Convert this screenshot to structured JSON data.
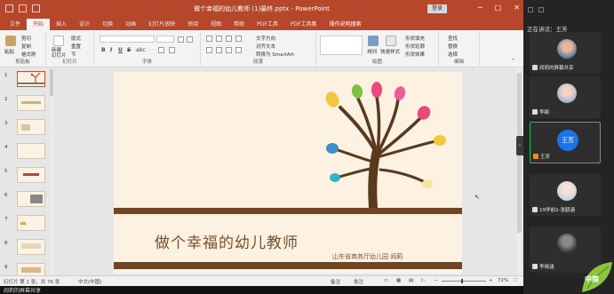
{
  "window": {
    "title": "做个幸福的幼儿教师 (1)最终.pptx - PowerPoint",
    "login_label": "登录",
    "controls": [
      "─",
      "□",
      "✕"
    ]
  },
  "tabs": [
    "文件",
    "开始",
    "插入",
    "设计",
    "切换",
    "动画",
    "幻灯片放映",
    "审阅",
    "视图",
    "帮助",
    "PDF工具",
    "PDF工具集",
    "操作说明搜索"
  ],
  "active_tab": "开始",
  "ribbon": {
    "clipboard": {
      "label": "剪贴板",
      "paste": "粘贴",
      "cut": "剪切",
      "copy": "复制",
      "format_painter": "格式刷"
    },
    "slides": {
      "label": "幻灯片",
      "new_slide": "新建\n幻灯片",
      "layout": "版式",
      "reset": "重置",
      "section": "节"
    },
    "font": {
      "label": "字体",
      "bold": "B",
      "italic": "I",
      "underline": "U",
      "strike": "S",
      "shadow": "abc"
    },
    "paragraph": {
      "label": "段落",
      "text_direction": "文字方向",
      "align_text": "对齐文本",
      "smartart": "转换为 SmartArt"
    },
    "drawing": {
      "label": "绘图",
      "arrange": "排列",
      "quick_styles": "快速样式",
      "fill": "形状填充",
      "outline": "形状轮廓",
      "effects": "形状效果"
    },
    "editing": {
      "label": "编辑",
      "find": "查找",
      "replace": "替换",
      "select": "选择"
    }
  },
  "thumbnails": [
    "1",
    "2",
    "3",
    "4",
    "5",
    "6",
    "7",
    "8",
    "9"
  ],
  "slide": {
    "title": "做个幸福的幼儿教师",
    "subtitle": "山东省商务厅幼儿园  阎莉"
  },
  "status": {
    "slide_info": "幻灯片 第 1 张，共 76 张",
    "language": "中文(中国)",
    "notes": "备注",
    "comments": "批注",
    "zoom": "72%"
  },
  "bottom_text": "阎莉的屏幕共享",
  "meeting": {
    "speaking_label": "正在讲话：王芳",
    "participants": [
      {
        "name": "阎莉的屏幕共享",
        "kind": "photo"
      },
      {
        "name": "李颖",
        "kind": "photo"
      },
      {
        "name": "王芳",
        "kind": "initials",
        "initials": "王芳"
      },
      {
        "name": "19学前2-张鹤涵",
        "kind": "photo"
      },
      {
        "name": "李晓涵",
        "kind": "photo"
      }
    ],
    "logo_text": "中简"
  },
  "colors": {
    "accent": "#b7472a",
    "slide_brown": "#6f4524",
    "meeting_bg": "#242424",
    "active_speaker": "#3bb36a",
    "avatar_blue": "#1b74e8"
  }
}
